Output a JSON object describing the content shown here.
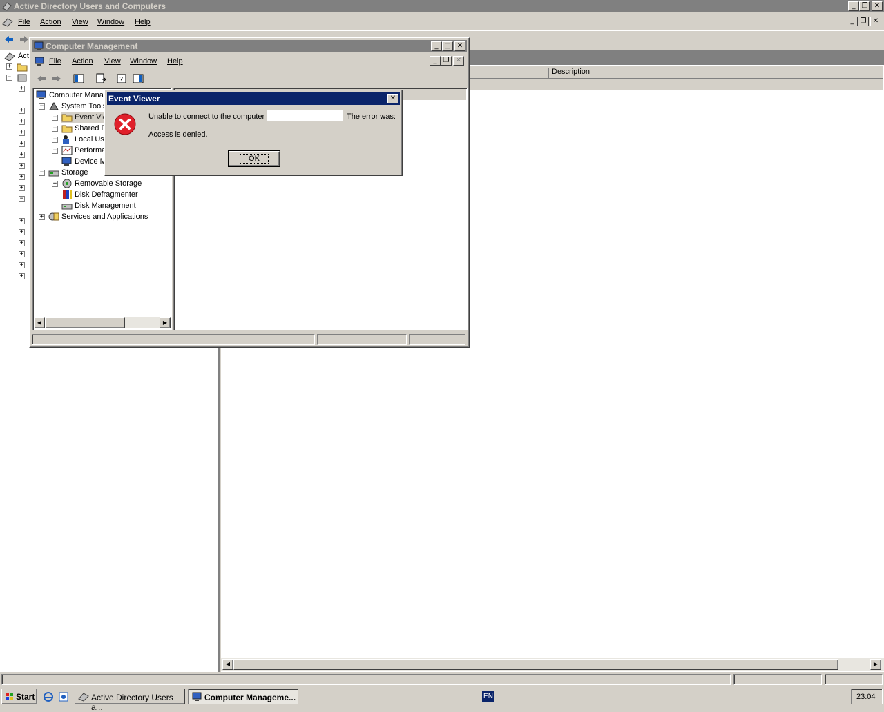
{
  "ad_window": {
    "title": "Active Directory Users and Computers",
    "menu": [
      "File",
      "Action",
      "View",
      "Window",
      "Help"
    ],
    "tree_root_label": "Act",
    "column_description": "Description"
  },
  "cm_window": {
    "title": "Computer Management",
    "menu": [
      "File",
      "Action",
      "View",
      "Window",
      "Help"
    ],
    "tree": {
      "root": "Computer Manac",
      "system_tools": "System Tools",
      "event_viewer": "Event Vie",
      "shared_folders": "Shared F",
      "local_users": "Local Use",
      "performance": "Performa",
      "device_manager": "Device M",
      "storage": "Storage",
      "removable_storage": "Removable Storage",
      "disk_defragmenter": "Disk Defragmenter",
      "disk_management": "Disk Management",
      "services_apps": "Services and Applications"
    }
  },
  "dialog": {
    "title": "Event Viewer",
    "message_part1": "Unable to connect to the computer",
    "message_part2": "The error was:",
    "detail": "Access is denied.",
    "ok_label": "OK"
  },
  "taskbar": {
    "start_label": "Start",
    "tasks": [
      "Active Directory Users a...",
      "Computer Manageme..."
    ],
    "language": "EN",
    "clock": "23:04"
  },
  "colors": {
    "title_active": "#0a246a",
    "title_inactive": "#808080",
    "face": "#d4d0c8",
    "error_red": "#e0202a"
  }
}
